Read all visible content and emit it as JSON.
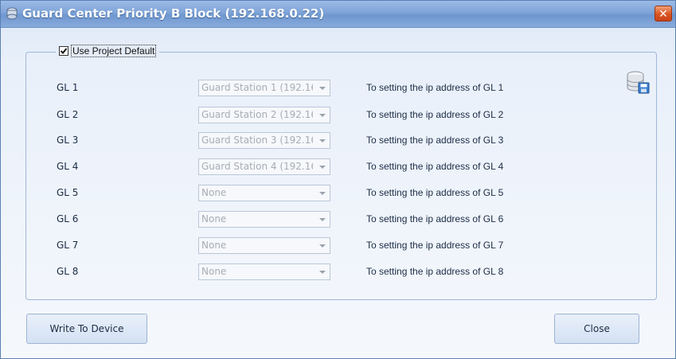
{
  "window": {
    "title": "Guard Center Priority B Block (192.168.0.22)",
    "close_glyph": "✕"
  },
  "group": {
    "use_project_default_label": "Use Project Default",
    "use_project_default_checked": true
  },
  "rows": [
    {
      "label": "GL 1",
      "value": "Guard Station 1 (192.16",
      "desc": "To setting the ip address of GL 1"
    },
    {
      "label": "GL 2",
      "value": "Guard Station 2 (192.16",
      "desc": "To setting the ip address of GL 2"
    },
    {
      "label": "GL 3",
      "value": "Guard Station 3 (192.16",
      "desc": "To setting the ip address of GL 3"
    },
    {
      "label": "GL 4",
      "value": "Guard Station 4 (192.16",
      "desc": "To setting the ip address of GL 4"
    },
    {
      "label": "GL 5",
      "value": "None",
      "desc": "To setting the ip address of GL 5"
    },
    {
      "label": "GL 6",
      "value": "None",
      "desc": "To setting the ip address of GL 6"
    },
    {
      "label": "GL 7",
      "value": "None",
      "desc": "To setting the ip address of GL 7"
    },
    {
      "label": "GL 8",
      "value": "None",
      "desc": "To setting the ip address of GL 8"
    }
  ],
  "buttons": {
    "write": "Write To Device",
    "close": "Close"
  },
  "icons": {
    "app": "dialog-app-icon",
    "save": "database-save-icon"
  },
  "colors": {
    "title_bar": "#7ea4d8",
    "close_button": "#d9541f",
    "disabled_text": "#a8adb4"
  }
}
